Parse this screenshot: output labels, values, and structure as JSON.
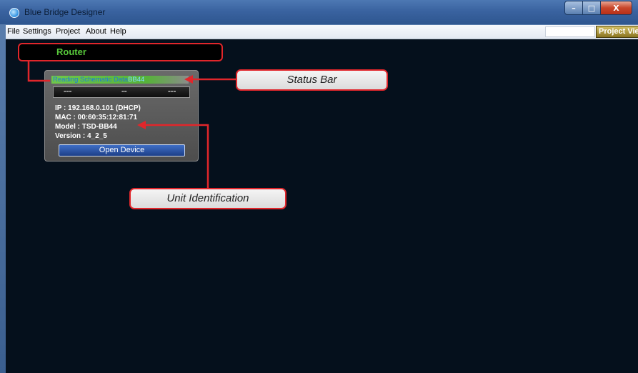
{
  "window": {
    "title": "Blue Bridge Designer",
    "controls": {
      "minimize": "–",
      "maximize": "□",
      "close": "X"
    }
  },
  "menu": {
    "items": [
      "File",
      "Settings",
      "Project",
      "About",
      "Help"
    ],
    "project_view_button": "Project View"
  },
  "router": {
    "label": "Router"
  },
  "device": {
    "status": "Reading Schematic Data",
    "status_suffix": "BB44",
    "ip": "IP : 192.168.0.101 (DHCP)",
    "mac": "MAC : 00:60:35:12:81:71",
    "model": "Model : TSD-BB44",
    "version": "Version : 4_2_5",
    "open_button": "Open Device"
  },
  "callouts": {
    "status_bar": "Status Bar",
    "unit_identification": "Unit Identification"
  },
  "colors": {
    "callout_border": "#e1262b",
    "router_text": "#58c93b",
    "workspace_bg": "#05101c",
    "accent_button": "#2a55a8"
  }
}
